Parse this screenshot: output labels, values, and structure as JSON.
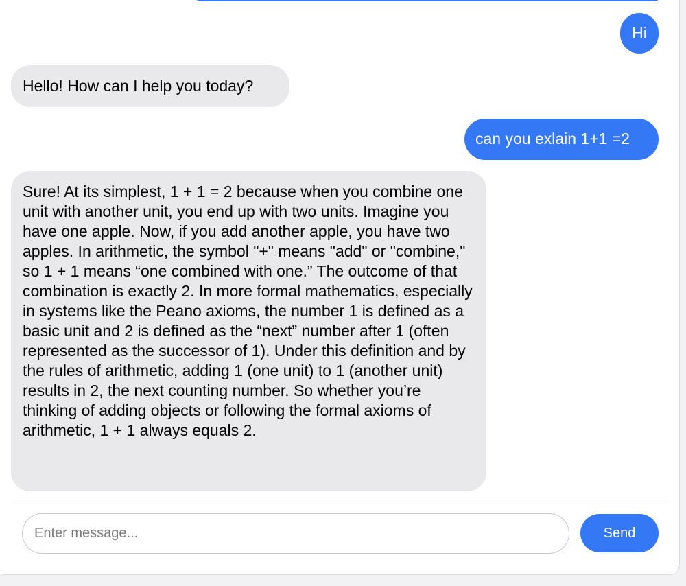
{
  "colors": {
    "user_bubble": "#3478f6",
    "bot_bubble": "#e9e9ec",
    "send_button": "#3478f6"
  },
  "messages": [
    {
      "role": "user",
      "text": "Hi"
    },
    {
      "role": "assistant",
      "text": "Hello! How can I help you today?"
    },
    {
      "role": "user",
      "text": "can you exlain 1+1 =2"
    },
    {
      "role": "assistant",
      "text": "Sure! At its simplest, 1 + 1 = 2 because when you combine one unit with another unit, you end up with two units. Imagine you have one apple. Now, if you add another apple, you have two apples. In arithmetic, the symbol \"+\" means \"add\" or \"combine,\" so 1 + 1 means “one combined with one.” The outcome of that combination is exactly 2. In more formal mathematics, especially in systems like the Peano axioms, the number 1 is defined as a basic unit and 2 is defined as the “next” number after 1 (often represented as the successor of 1). Under this definition and by the rules of arithmetic, adding 1 (one unit) to 1 (another unit) results in 2, the next counting number. So whether you’re thinking of adding objects or following the formal axioms of arithmetic, 1 + 1 always equals 2."
    }
  ],
  "composer": {
    "placeholder": "Enter message...",
    "value": "",
    "send_label": "Send"
  }
}
